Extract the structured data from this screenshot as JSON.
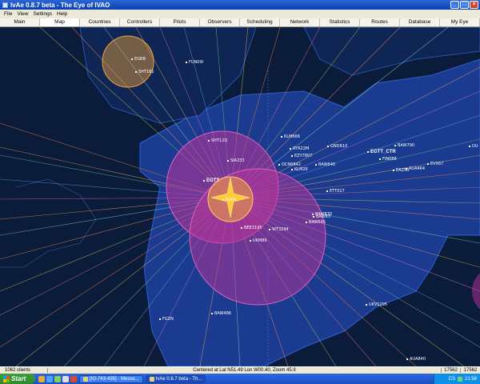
{
  "window": {
    "title": "IvAe 0.8.7 beta - The Eye of IVAO",
    "buttons": {
      "minimize": "_",
      "maximize": "□",
      "close": "×"
    }
  },
  "menu": [
    "File",
    "View",
    "Settings",
    "Help"
  ],
  "tabs": [
    {
      "label": "Main",
      "active": false
    },
    {
      "label": "Map",
      "active": true
    },
    {
      "label": "Countries",
      "active": false
    },
    {
      "label": "Controllers",
      "active": false
    },
    {
      "label": "Pilots",
      "active": false
    },
    {
      "label": "Observers",
      "active": false
    },
    {
      "label": "Scheduling",
      "active": false
    },
    {
      "label": "Network",
      "active": false
    },
    {
      "label": "Statistics",
      "active": false
    },
    {
      "label": "Routes",
      "active": false
    },
    {
      "label": "Database",
      "active": false
    },
    {
      "label": "My Eye",
      "active": false
    }
  ],
  "map": {
    "colors": {
      "ocean": "#0b1b3a",
      "fir_fill": "#1a3b8f",
      "fir_border": "#2f5fd0",
      "zone_magenta": "#c0349b",
      "zone_orange": "#f2a53a",
      "label": "#ffffff"
    },
    "labels": [
      {
        "id": "egbb",
        "text": "EGBB"
      },
      {
        "id": "sht101",
        "text": "SHT181"
      },
      {
        "id": "fun09",
        "text": "FUN09I"
      },
      {
        "id": "klm66",
        "text": "KLM666"
      },
      {
        "id": "ryr22",
        "text": "RYR22M"
      },
      {
        "id": "ezy",
        "text": "EZY7807"
      },
      {
        "id": "ocn",
        "text": "OCN6842"
      },
      {
        "id": "gnd",
        "text": "GNDR10"
      },
      {
        "id": "egtt_ctr",
        "text": "EGTT_CTR"
      },
      {
        "id": "baw790",
        "text": "BAW790"
      },
      {
        "id": "fin",
        "text": "FIN088"
      },
      {
        "id": "aua",
        "text": "AUA464"
      },
      {
        "id": "evx",
        "text": "EVX67"
      },
      {
        "id": "eaz",
        "text": "EAZ56"
      },
      {
        "id": "du",
        "text": "DU"
      },
      {
        "id": "sht12q",
        "text": "SHT12Q"
      },
      {
        "id": "egtt",
        "text": "EGTT"
      },
      {
        "id": "baw640",
        "text": "BAW640"
      },
      {
        "id": "klm",
        "text": "KLM26"
      },
      {
        "id": "ett",
        "text": "ETT017"
      },
      {
        "id": "bau",
        "text": "BAW83"
      },
      {
        "id": "baw870",
        "text": "BAW870"
      },
      {
        "id": "baw565",
        "text": "BAW565"
      },
      {
        "id": "bee",
        "text": "BEE3195"
      },
      {
        "id": "wt",
        "text": "WT3294"
      },
      {
        "id": "uk",
        "text": "UKM89"
      },
      {
        "id": "ukv",
        "text": "UKV1295"
      },
      {
        "id": "baw486",
        "text": "BAW486"
      },
      {
        "id": "fgz",
        "text": "FGZN"
      },
      {
        "id": "aua840",
        "text": "AUA840"
      },
      {
        "id": "sia",
        "text": "SIA233"
      },
      {
        "id": "egkk",
        "text": "EGKK"
      }
    ]
  },
  "status": {
    "clients": "1062 clients",
    "center": "Centered at Lat N51.49 Lon W00.40, Zoom 45.9",
    "value_a": "17562",
    "value_b": "17562"
  },
  "taskbar": {
    "start": "Start",
    "tasks": [
      {
        "label": "[IO-743-435] - Messe...",
        "active": false
      },
      {
        "label": "IvAe 0.8.7 beta - Th...",
        "active": true
      }
    ],
    "tray_lang": "CS",
    "clock": "21:58"
  }
}
